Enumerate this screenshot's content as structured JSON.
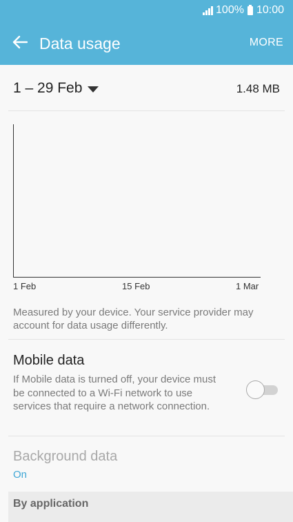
{
  "status_bar": {
    "battery_percent": "100%",
    "time": "10:00",
    "signal_icon": "signal-icon",
    "battery_icon": "battery-icon"
  },
  "app_bar": {
    "back_icon": "back-arrow-icon",
    "title": "Data usage",
    "more_label": "MORE"
  },
  "period": {
    "label": "1 – 29 Feb",
    "total": "1.48 MB"
  },
  "chart_data": {
    "type": "line",
    "x_ticks": [
      "1 Feb",
      "15 Feb",
      "1 Mar"
    ],
    "series": [],
    "grid": false
  },
  "info_text": "Measured by your device. Your service provider may account for data usage differently.",
  "mobile_data": {
    "title": "Mobile data",
    "description": "If Mobile data is turned off, your device must be connected to a Wi-Fi network to use services that require a network connection.",
    "enabled": false
  },
  "background_data": {
    "title": "Background data",
    "value": "On"
  },
  "section": {
    "by_application": "By application"
  },
  "colors": {
    "accent": "#56b4d9",
    "link": "#3fa7d6"
  }
}
